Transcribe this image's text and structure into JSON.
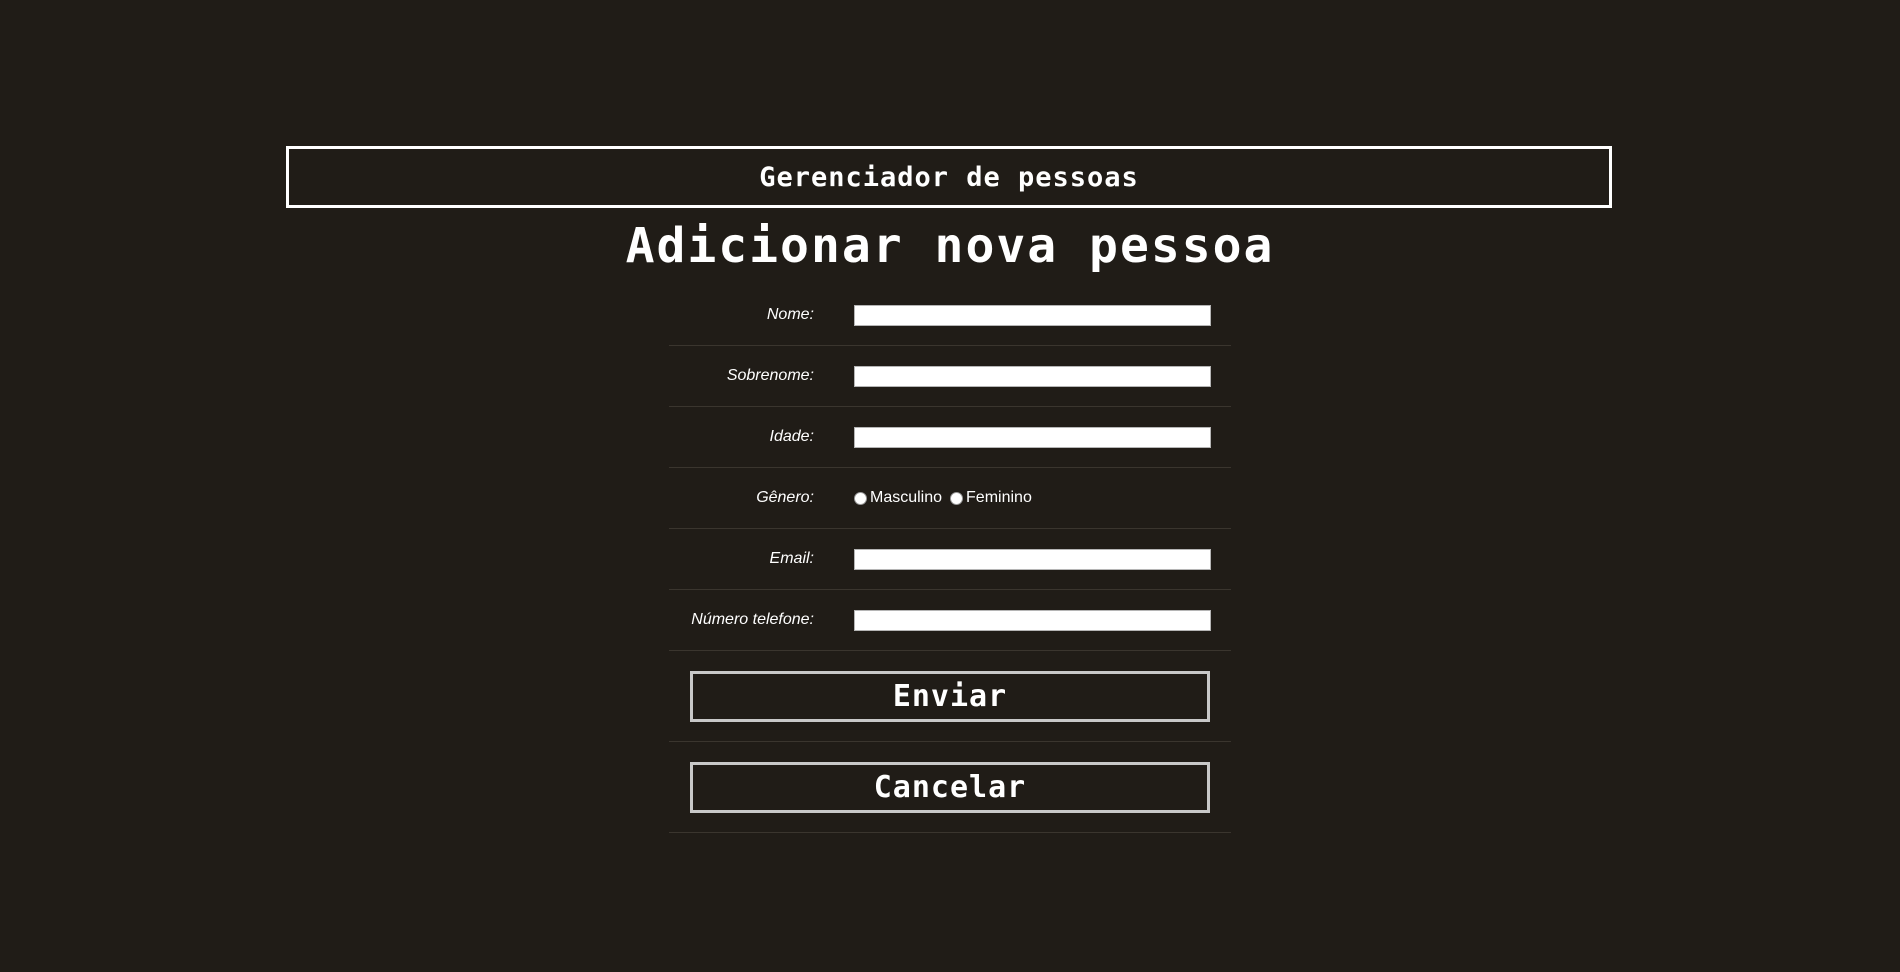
{
  "header": {
    "title": "Gerenciador de pessoas"
  },
  "page": {
    "title": "Adicionar nova pessoa"
  },
  "form": {
    "fields": {
      "nome": {
        "label": "Nome:",
        "value": ""
      },
      "sobrenome": {
        "label": "Sobrenome:",
        "value": ""
      },
      "idade": {
        "label": "Idade:",
        "value": ""
      },
      "genero": {
        "label": "Gênero:",
        "options": [
          "Masculino",
          "Feminino"
        ],
        "selected": null
      },
      "email": {
        "label": "Email:",
        "value": ""
      },
      "telefone": {
        "label": "Número telefone:",
        "value": ""
      }
    },
    "submit_label": "Enviar",
    "cancel_label": "Cancelar"
  },
  "colors": {
    "background": "#201c17",
    "text": "#ffffff",
    "border": "#ffffff",
    "button_border": "#c8c8c8"
  }
}
